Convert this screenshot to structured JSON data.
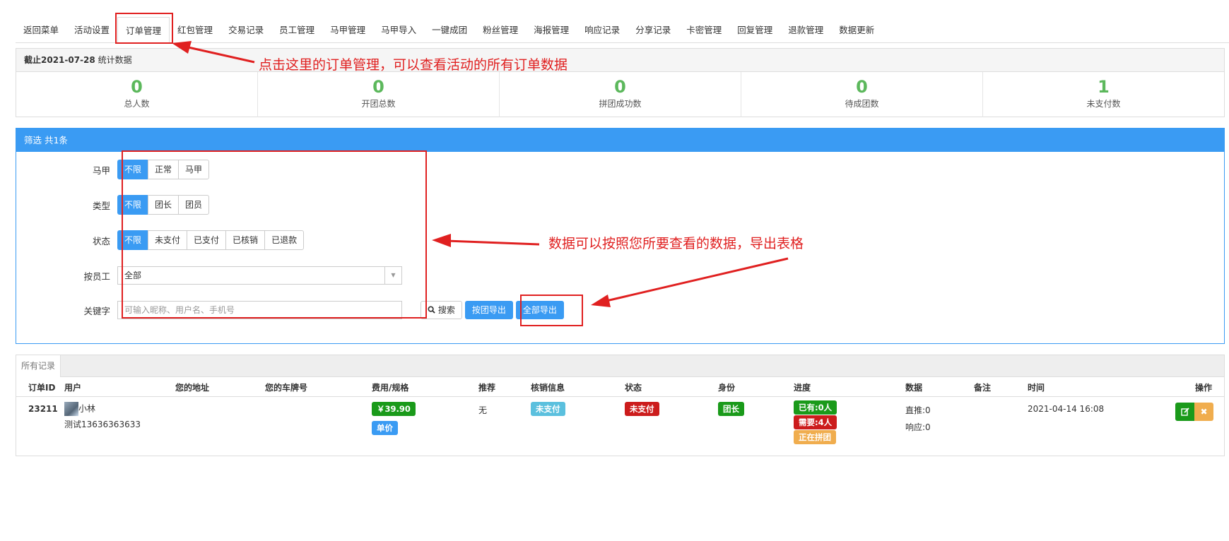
{
  "topnav": {
    "tabs": [
      "返回菜单",
      "活动设置",
      "订单管理",
      "红包管理",
      "交易记录",
      "员工管理",
      "马甲管理",
      "马甲导入",
      "一键成团",
      "粉丝管理",
      "海报管理",
      "响应记录",
      "分享记录",
      "卡密管理",
      "回复管理",
      "退款管理",
      "数据更新"
    ],
    "active_index": 2
  },
  "stats": {
    "head_bold": "截止2021-07-28",
    "head_rest": " 统计数据",
    "items": [
      {
        "value": "0",
        "label": "总人数"
      },
      {
        "value": "0",
        "label": "开团总数"
      },
      {
        "value": "0",
        "label": "拼团成功数"
      },
      {
        "value": "0",
        "label": "待成团数"
      },
      {
        "value": "1",
        "label": "未支付数"
      }
    ]
  },
  "filter": {
    "title": "筛选 共1条",
    "majia": {
      "label": "马甲",
      "options": [
        "不限",
        "正常",
        "马甲"
      ]
    },
    "type": {
      "label": "类型",
      "options": [
        "不限",
        "团长",
        "团员"
      ]
    },
    "status": {
      "label": "状态",
      "options": [
        "不限",
        "未支付",
        "已支付",
        "已核销",
        "已退款"
      ]
    },
    "staff": {
      "label": "按员工",
      "value": "全部"
    },
    "keyword": {
      "label": "关键字",
      "placeholder": "可输入昵称、用户名、手机号"
    },
    "search_label": "搜索",
    "export_group_label": "按团导出",
    "export_all_label": "全部导出"
  },
  "records": {
    "tab": "所有记录",
    "headers": [
      "订单ID",
      "用户",
      "您的地址",
      "您的车牌号",
      "费用/规格",
      "推荐",
      "核销信息",
      "状态",
      "身份",
      "进度",
      "数据",
      "备注",
      "时间",
      "操作"
    ],
    "row": {
      "id": "23211",
      "user_name": "小林",
      "user_sub": "测试13636363633",
      "fee": "￥39.90",
      "spec": "单价",
      "recommend": "无",
      "verify": "未支付",
      "status": "未支付",
      "role": "团长",
      "progress_have": "已有:0人",
      "progress_need": "需要:4人",
      "progress_state": "正在拼团",
      "data_push": "直推:0",
      "data_resp": "响应:0",
      "time": "2021-04-14 16:08"
    }
  },
  "annotations": {
    "note1": "点击这里的订单管理，可以查看活动的所有订单数据",
    "note2": "数据可以按照您所要查看的数据，导出表格"
  },
  "colors": {
    "primary": "#3a9bf3",
    "success": "#5cb85c",
    "green_badge": "#1a9a1a",
    "red_badge": "#cc1c1c",
    "info_badge": "#5bc0de",
    "warning_badge": "#f0ad4e",
    "annotation_red": "#e02020"
  }
}
